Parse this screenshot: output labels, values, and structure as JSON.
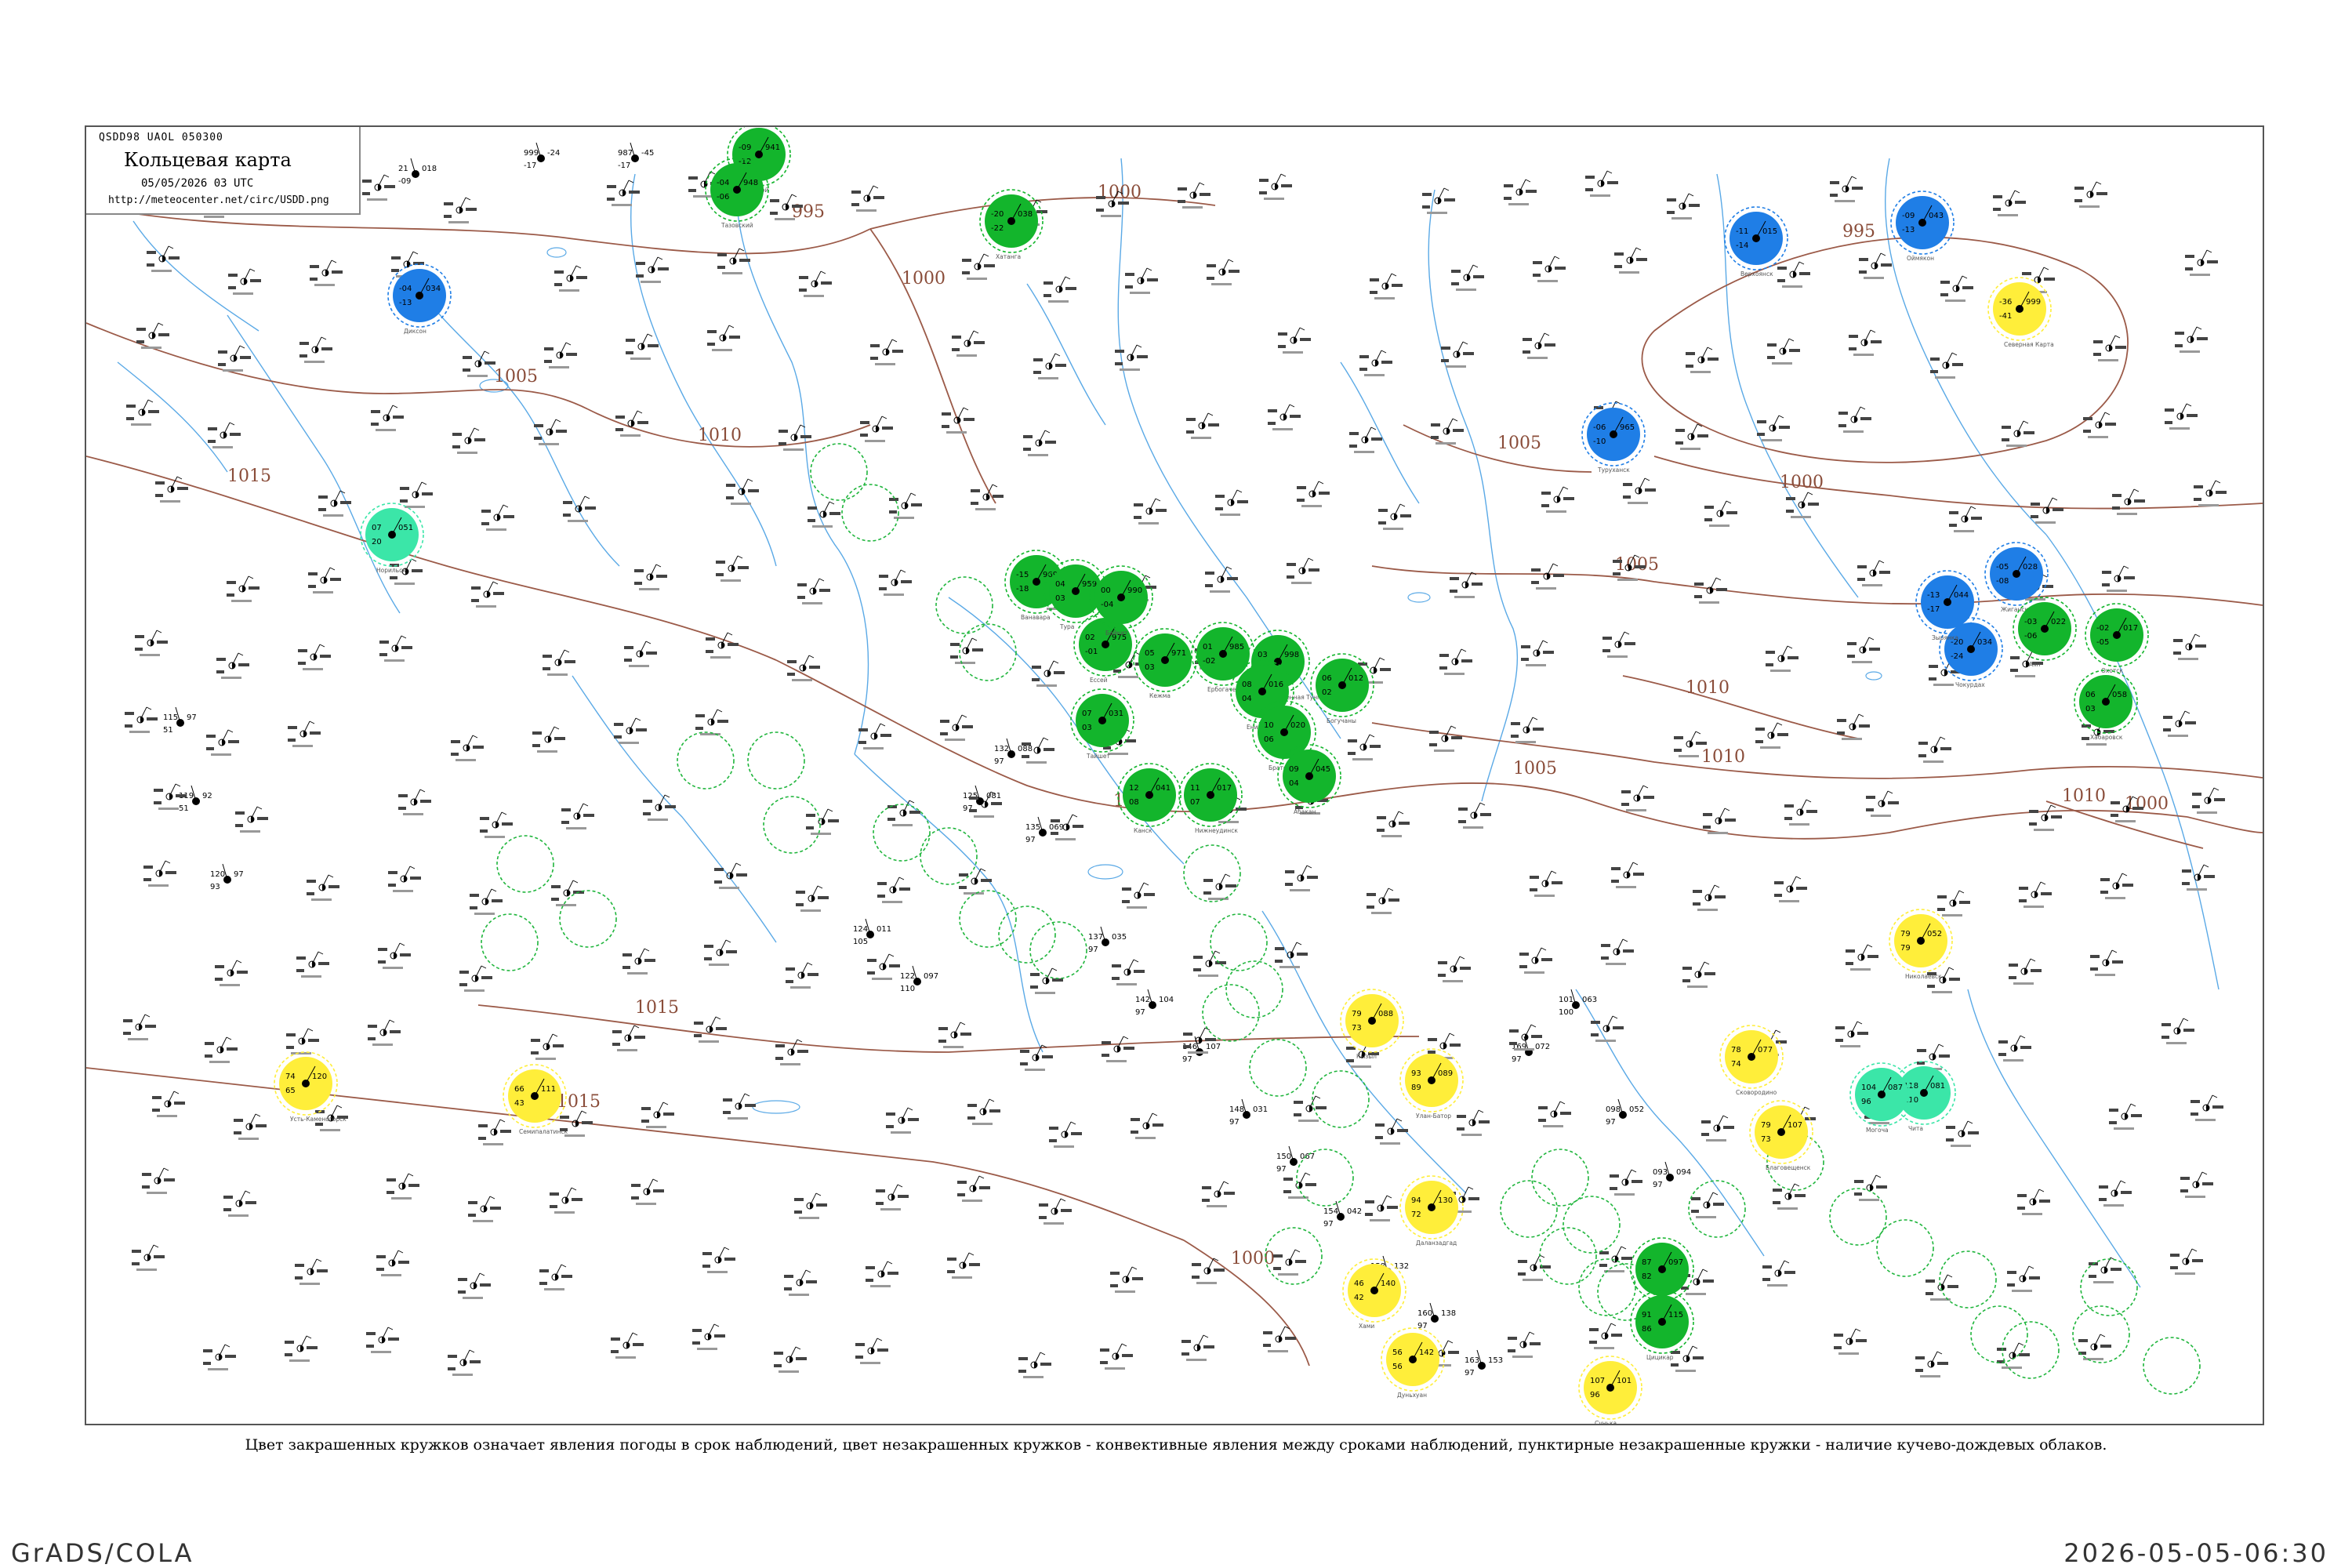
{
  "header": {
    "code": "QSDD98 UAOL 050300",
    "title": "Кольцевая карта",
    "date": "05/05/2026 03 UTC",
    "url": "http://meteocenter.net/circ/USDD.png"
  },
  "caption": "Цвет закрашенных кружков означает явления погоды в срок наблюдений, цвет незакрашенных кружков - конвективные явления между сроками наблюдений, пунктирные незакрашенные кружки - наличие кучево-дождевых облаков.",
  "footer": {
    "left": "GrADS/COLA",
    "right": "2026-05-05-06:30"
  },
  "colors": {
    "river": "#5aa9e6",
    "isobar": "#9b5a48",
    "green": "#13b52c",
    "blue": "#1f7ee6",
    "yellow": "#ffee3a",
    "teal": "#3be6a8",
    "dashed": "#1fb53c"
  },
  "isobar_labels": [
    "995",
    "1000",
    "1005",
    "1010",
    "1015",
    "1010",
    "1005",
    "1000",
    "1000",
    "995",
    "1000",
    "1005",
    "1010",
    "1015",
    "1000",
    "1005",
    "1010",
    "1015",
    "1010"
  ],
  "stations": [
    {
      "id": "s1",
      "kind": "green",
      "t": "-09",
      "p": "941",
      "td": "-12",
      "name": "Уренгой"
    },
    {
      "id": "s2",
      "kind": "green",
      "t": "-04",
      "p": "948",
      "td": "-06",
      "name": "Тазовский"
    },
    {
      "id": "s3",
      "kind": "blue",
      "t": "-04",
      "p": "034",
      "td": "-13",
      "name": "Диксон"
    },
    {
      "id": "s4",
      "kind": "green",
      "t": "-20",
      "p": "038",
      "td": "-22",
      "name": "Хатанга"
    },
    {
      "id": "s5",
      "kind": "teal",
      "t": "07",
      "p": "051",
      "td": "20",
      "name": "Норильск"
    },
    {
      "id": "s6",
      "kind": "blue",
      "t": "-06",
      "p": "965",
      "td": "-10",
      "name": "Туруханск"
    },
    {
      "id": "s7",
      "kind": "green",
      "t": "-15",
      "p": "969",
      "td": "-18",
      "name": "Ванавара"
    },
    {
      "id": "s8",
      "kind": "green",
      "t": "04",
      "p": "959",
      "td": "03",
      "name": "Тура"
    },
    {
      "id": "s9",
      "kind": "green",
      "t": "02",
      "p": "975",
      "td": "-01",
      "name": "Ессей"
    },
    {
      "id": "s10",
      "kind": "green",
      "t": "00",
      "p": "990",
      "td": "-04",
      "name": "Байкит"
    },
    {
      "id": "s11",
      "kind": "green",
      "t": "05",
      "p": "971",
      "td": "03",
      "name": "Кежма"
    },
    {
      "id": "s12",
      "kind": "green",
      "t": "01",
      "p": "985",
      "td": "-02",
      "name": "Ербогачен"
    },
    {
      "id": "s13",
      "kind": "green",
      "t": "03",
      "p": "998",
      "td": "01",
      "name": "Подкаменная Тунгуска"
    },
    {
      "id": "s14",
      "kind": "green",
      "t": "06",
      "p": "012",
      "td": "02",
      "name": "Богучаны"
    },
    {
      "id": "s15",
      "kind": "green",
      "t": "08",
      "p": "016",
      "td": "04",
      "name": "Енисейск"
    },
    {
      "id": "s16",
      "kind": "green",
      "t": "10",
      "p": "020",
      "td": "06",
      "name": "Братск"
    },
    {
      "id": "s17",
      "kind": "green",
      "t": "07",
      "p": "031",
      "td": "03",
      "name": "Тайшет"
    },
    {
      "id": "s18",
      "kind": "green",
      "t": "12",
      "p": "041",
      "td": "08",
      "name": "Канск"
    },
    {
      "id": "s19",
      "kind": "green",
      "t": "11",
      "p": "017",
      "td": "07",
      "name": "Нижнеудинск"
    },
    {
      "id": "s20",
      "kind": "green",
      "t": "09",
      "p": "045",
      "td": "04",
      "name": "Абакан"
    },
    {
      "id": "s21",
      "kind": "yellow",
      "t": "79",
      "p": "088",
      "td": "73",
      "name": "Кызыл"
    },
    {
      "id": "s22",
      "kind": "yellow",
      "t": "93",
      "p": "089",
      "td": "89",
      "name": "Улан-Батор"
    },
    {
      "id": "s23",
      "kind": "yellow",
      "t": "74",
      "p": "120",
      "td": "65",
      "name": "Усть-Каменогорск"
    },
    {
      "id": "s24",
      "kind": "yellow",
      "t": "66",
      "p": "111",
      "td": "43",
      "name": "Семипалатинск"
    },
    {
      "id": "s25",
      "kind": "yellow",
      "t": "94",
      "p": "130",
      "td": "72",
      "name": "Даланзадгад"
    },
    {
      "id": "s26",
      "kind": "yellow",
      "t": "46",
      "p": "140",
      "td": "42",
      "name": "Хами"
    },
    {
      "id": "s27",
      "kind": "yellow",
      "t": "56",
      "p": "142",
      "td": "56",
      "name": "Дуньхуан"
    },
    {
      "id": "s28",
      "kind": "yellow",
      "t": "78",
      "p": "077",
      "td": "74",
      "name": "Сковородино"
    },
    {
      "id": "s29",
      "kind": "yellow",
      "t": "79",
      "p": "052",
      "td": "79",
      "name": "Николаевск"
    },
    {
      "id": "s30",
      "kind": "yellow",
      "t": "79",
      "p": "107",
      "td": "73",
      "name": "Благовещенск"
    },
    {
      "id": "s31",
      "kind": "yellow",
      "t": "-36",
      "p": "999",
      "td": "-41",
      "name": "Северная Карта"
    },
    {
      "id": "s32",
      "kind": "yellow",
      "t": "107",
      "p": "101",
      "td": "96",
      "name": "Сунька"
    },
    {
      "id": "s33",
      "kind": "blue",
      "t": "-09",
      "p": "043",
      "td": "-13",
      "name": "Оймякон"
    },
    {
      "id": "s34",
      "kind": "blue",
      "t": "-11",
      "p": "015",
      "td": "-14",
      "name": "Верхоянск"
    },
    {
      "id": "s35",
      "kind": "blue",
      "t": "-05",
      "p": "028",
      "td": "-08",
      "name": "Жиганск"
    },
    {
      "id": "s36",
      "kind": "blue",
      "t": "-20",
      "p": "034",
      "td": "-24",
      "name": "Чокурдах"
    },
    {
      "id": "s37",
      "kind": "blue",
      "t": "-13",
      "p": "044",
      "td": "-17",
      "name": "Зырянка"
    },
    {
      "id": "s38",
      "kind": "green",
      "t": "-02",
      "p": "017",
      "td": "-05",
      "name": "Охотск"
    },
    {
      "id": "s39",
      "kind": "green",
      "t": "-03",
      "p": "022",
      "td": "-06",
      "name": "Аян"
    },
    {
      "id": "s40",
      "kind": "green",
      "t": "06",
      "p": "058",
      "td": "03",
      "name": "Хабаровск"
    },
    {
      "id": "s41",
      "kind": "teal",
      "t": "118",
      "p": "081",
      "td": "110",
      "name": "Чита"
    },
    {
      "id": "s42",
      "kind": "teal",
      "t": "104",
      "p": "087",
      "td": "96",
      "name": "Могоча"
    },
    {
      "id": "s43",
      "kind": "green",
      "t": "87",
      "p": "097",
      "td": "82",
      "name": "Хайлар"
    },
    {
      "id": "s44",
      "kind": "green",
      "t": "91",
      "p": "115",
      "td": "86",
      "name": "Цицикар"
    }
  ],
  "small_obs": [
    {
      "t": "21",
      "p": "018",
      "td": "-09"
    },
    {
      "t": "999",
      "p": "-24",
      "td": "-17"
    },
    {
      "t": "987",
      "p": "-45",
      "td": "-17"
    },
    {
      "t": "115",
      "p": "97",
      "td": "51"
    },
    {
      "t": "119",
      "p": "92",
      "td": "51"
    },
    {
      "t": "120",
      "p": "97",
      "td": "93"
    },
    {
      "t": "124",
      "p": "011",
      "td": "105"
    },
    {
      "t": "122",
      "p": "097",
      "td": "110"
    },
    {
      "t": "125",
      "p": "081",
      "td": "97"
    },
    {
      "t": "132",
      "p": "088",
      "td": "97"
    },
    {
      "t": "135",
      "p": "069",
      "td": "97"
    },
    {
      "t": "137",
      "p": "035",
      "td": "97"
    },
    {
      "t": "142",
      "p": "104",
      "td": "97"
    },
    {
      "t": "146",
      "p": "107",
      "td": "97"
    },
    {
      "t": "148",
      "p": "031",
      "td": "97"
    },
    {
      "t": "150",
      "p": "067",
      "td": "97"
    },
    {
      "t": "154",
      "p": "042",
      "td": "97"
    },
    {
      "t": "158",
      "p": "132",
      "td": "97"
    },
    {
      "t": "160",
      "p": "138",
      "td": "97"
    },
    {
      "t": "163",
      "p": "153",
      "td": "97"
    },
    {
      "t": "169",
      "p": "072",
      "td": "97"
    },
    {
      "t": "101",
      "p": "063",
      "td": "100"
    },
    {
      "t": "098",
      "p": "052",
      "td": "97"
    },
    {
      "t": "093",
      "p": "094",
      "td": "97"
    }
  ]
}
